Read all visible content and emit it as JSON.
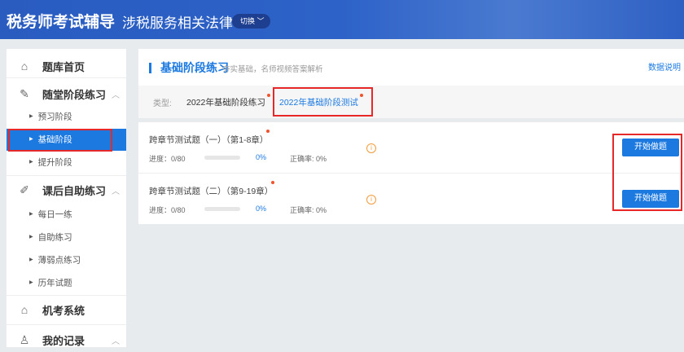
{
  "header": {
    "brand": "税务师考试辅导",
    "subject": "涉税服务相关法律",
    "switch_label": "切换 ﹀"
  },
  "sidebar": {
    "home": "题库首页",
    "class_practice": {
      "label": "随堂阶段练习",
      "items": [
        "预习阶段",
        "基础阶段",
        "提升阶段"
      ]
    },
    "self_practice": {
      "label": "课后自助练习",
      "items": [
        "每日一练",
        "自助练习",
        "薄弱点练习",
        "历年试题"
      ]
    },
    "exam_system": "机考系统",
    "my_records": "我的记录"
  },
  "main": {
    "title": "基础阶段练习",
    "subtitle": "夯实基础，名师视频答案解析",
    "data_link": "数据说明",
    "type_label": "类型:",
    "tabs": [
      {
        "label": "2022年基础阶段练习"
      },
      {
        "label": "2022年基础阶段测试"
      }
    ],
    "rows": [
      {
        "title": "跨章节测试题（一）（第1-8章）",
        "progress": "进度：0/80",
        "progress_value": 0,
        "percent": "0%",
        "accuracy": "正确率: 0%",
        "button": "开始做题"
      },
      {
        "title": "跨章节测试题（二）（第9-19章）",
        "progress": "进度：0/80",
        "progress_value": 0,
        "percent": "0%",
        "accuracy": "正确率: 0%",
        "button": "开始做题"
      }
    ]
  },
  "colors": {
    "accent": "#1b79e0",
    "header": "#2a5cc0",
    "highlight": "#e62828",
    "dot": "#f0522c"
  }
}
